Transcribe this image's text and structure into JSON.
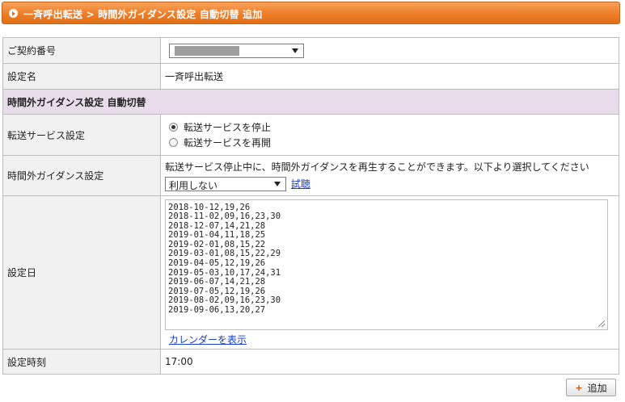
{
  "header": {
    "title": "一斉呼出転送 > 時間外ガイダンス設定 自動切替 追加"
  },
  "form": {
    "contract_label": "ご契約番号",
    "setting_name_label": "設定名",
    "setting_name_value": "一斉呼出転送",
    "section_title": "時間外ガイダンス設定 自動切替",
    "transfer_label": "転送サービス設定",
    "transfer_options": [
      "転送サービスを停止",
      "転送サービスを再開"
    ],
    "transfer_selected": 0,
    "guidance_label": "時間外ガイダンス設定",
    "guidance_desc": "転送サービス停止中に、時間外ガイダンスを再生することができます。以下より選択してください",
    "guidance_select_value": "利用しない",
    "guidance_trial_link": "試聴",
    "dates_label": "設定日",
    "dates_value": "2018-10-12,19,26\n2018-11-02,09,16,23,30\n2018-12-07,14,21,28\n2019-01-04,11,18,25\n2019-02-01,08,15,22\n2019-03-01,08,15,22,29\n2019-04-05,12,19,26\n2019-05-03,10,17,24,31\n2019-06-07,14,21,28\n2019-07-05,12,19,26\n2019-08-02,09,16,23,30\n2019-09-06,13,20,27",
    "calendar_link": "カレンダーを表示",
    "time_label": "設定時刻",
    "time_value": "17:00"
  },
  "actions": {
    "add_button": "追加"
  },
  "icons": {
    "header": "circle-arrow-icon",
    "add": "plus-icon",
    "select_arrow": "chevron-down-icon"
  },
  "colors": {
    "header_bg": "#ee7d28",
    "section_bg": "#e9dcea",
    "label_bg": "#f1f1f1",
    "link": "#1a3fc7"
  }
}
